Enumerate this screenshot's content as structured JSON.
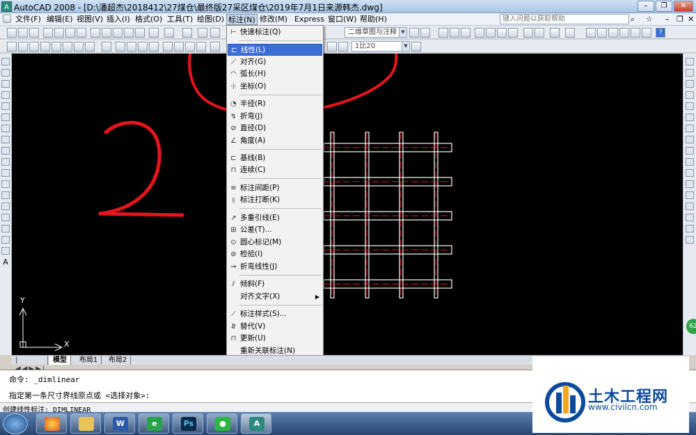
{
  "window": {
    "title": "AutoCAD 2008 - [D:\\潘超杰\\2018412\\27煤仓\\最终版27采区煤仓\\2019年7月1日来源韩杰.dwg]",
    "app_icon": "A"
  },
  "menubar": {
    "items": [
      {
        "label": "文件(F)"
      },
      {
        "label": "编辑(E)"
      },
      {
        "label": "视图(V)"
      },
      {
        "label": "插入(I)"
      },
      {
        "label": "格式(O)"
      },
      {
        "label": "工具(T)"
      },
      {
        "label": "绘图(D)"
      },
      {
        "label": "标注(N)"
      },
      {
        "label": "修改(M)"
      },
      {
        "label": "Express"
      },
      {
        "label": "窗口(W)"
      },
      {
        "label": "帮助(H)"
      }
    ],
    "help_placeholder": "键入问题以获取帮助"
  },
  "toolbar": {
    "workspace": "二维草图与注释",
    "scale": "1比20"
  },
  "dim_menu": {
    "items": [
      {
        "label": "快速标注(Q)",
        "icon": "quick-dim-icon"
      },
      {
        "label": "线性(L)",
        "icon": "linear-dim-icon",
        "highlighted": true
      },
      {
        "label": "对齐(G)",
        "icon": "aligned-dim-icon"
      },
      {
        "label": "弧长(H)",
        "icon": "arc-length-icon"
      },
      {
        "label": "坐标(O)",
        "icon": "ordinate-icon"
      },
      {
        "label": "半径(R)",
        "icon": "radius-icon"
      },
      {
        "label": "折弯(J)",
        "icon": "jogged-icon"
      },
      {
        "label": "直径(D)",
        "icon": "diameter-icon"
      },
      {
        "label": "角度(A)",
        "icon": "angle-icon"
      },
      {
        "label": "基线(B)",
        "icon": "baseline-icon"
      },
      {
        "label": "连续(C)",
        "icon": "continue-icon"
      },
      {
        "label": "标注间距(P)",
        "icon": "dim-space-icon"
      },
      {
        "label": "标注打断(K)",
        "icon": "dim-break-icon"
      },
      {
        "label": "多重引线(E)",
        "icon": "mleader-icon"
      },
      {
        "label": "公差(T)...",
        "icon": "tolerance-icon"
      },
      {
        "label": "圆心标记(M)",
        "icon": "center-mark-icon"
      },
      {
        "label": "检验(I)",
        "icon": "inspect-icon"
      },
      {
        "label": "折弯线性(J)",
        "icon": "jog-linear-icon"
      },
      {
        "label": "倾斜(F)",
        "icon": "oblique-icon"
      },
      {
        "label": "对齐文字(X)",
        "icon": "",
        "submenu": true
      },
      {
        "label": "标注样式(S)...",
        "icon": "dim-style-icon"
      },
      {
        "label": "替代(V)",
        "icon": "override-icon"
      },
      {
        "label": "更新(U)",
        "icon": "update-icon"
      },
      {
        "label": "重新关联标注(N)",
        "icon": ""
      }
    ]
  },
  "canvas": {
    "axis_y": "Y",
    "axis_x": "X",
    "annotation_number": "2"
  },
  "tabs": [
    {
      "label": "模型"
    },
    {
      "label": "布局1"
    },
    {
      "label": "布局2"
    }
  ],
  "command": {
    "line1": "命令: _dimlinear",
    "line2": "指定第一条尺寸界线原点或 <选择对象>:"
  },
  "status": {
    "text": "创建线性标注:  DIMLINEAR"
  },
  "watermark": {
    "title": "土木工程网",
    "url": "www.civilcn.com"
  },
  "badge": "62",
  "colors": {
    "highlight": "#3b6fd6",
    "canvas": "#000000",
    "annotation_red": "#e8141c"
  }
}
